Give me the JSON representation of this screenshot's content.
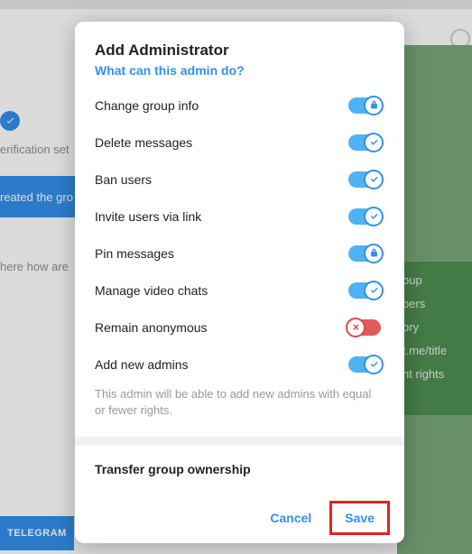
{
  "colors": {
    "accent": "#3390ec",
    "danger": "#d84949"
  },
  "background": {
    "verification_text": "erification set",
    "banner_text": "reated the gro",
    "message_text": "here how are",
    "button_text": "TELEGRAM",
    "panel": {
      "line1": "oup",
      "line2": "bers",
      "line3": "ory",
      "line4": "t.me/title",
      "line5": "nt rights"
    }
  },
  "modal": {
    "title": "Add Administrator",
    "subtitle": "What can this admin do?",
    "permissions": [
      {
        "label": "Change group info",
        "on": true,
        "icon": "lock"
      },
      {
        "label": "Delete messages",
        "on": true,
        "icon": "check"
      },
      {
        "label": "Ban users",
        "on": true,
        "icon": "check"
      },
      {
        "label": "Invite users via link",
        "on": true,
        "icon": "check"
      },
      {
        "label": "Pin messages",
        "on": true,
        "icon": "lock"
      },
      {
        "label": "Manage video chats",
        "on": true,
        "icon": "check"
      },
      {
        "label": "Remain anonymous",
        "on": false,
        "icon": "x"
      },
      {
        "label": "Add new admins",
        "on": true,
        "icon": "check"
      }
    ],
    "note": "This admin will be able to add new admins with equal or fewer rights.",
    "transfer": "Transfer group ownership",
    "cancel": "Cancel",
    "save": "Save"
  }
}
